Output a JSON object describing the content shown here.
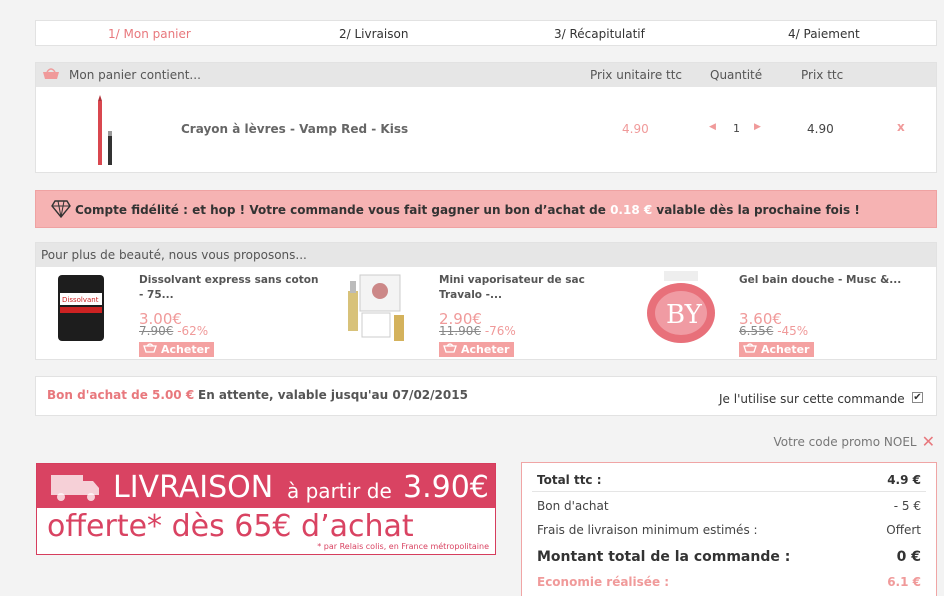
{
  "steps": {
    "s1": "1/ Mon panier",
    "s2": "2/ Livraison",
    "s3": "3/ Récapitulatif",
    "s4": "4/ Paiement"
  },
  "cart": {
    "heading": "Mon panier contient...",
    "col_unit": "Prix unitaire ttc",
    "col_qty": "Quantité",
    "col_total": "Prix ttc",
    "item": {
      "name": "Crayon à lèvres - Vamp Red - Kiss",
      "unit_price": "4.90",
      "qty": "1",
      "total": "4.90",
      "remove": "x"
    }
  },
  "loyalty": {
    "before": "Compte fidélité : et hop ! Votre commande vous fait gagner un bon d’achat de ",
    "amount": "0.18 €",
    "after": " valable dès la prochaine fois !"
  },
  "suggest": {
    "heading": "Pour plus de beauté, nous vous proposons...",
    "buy_label": "Acheter",
    "products": [
      {
        "name": "Dissolvant express sans coton - 75...",
        "price": "3.00€",
        "old": "7.90€",
        "disc": "-62%"
      },
      {
        "name": "Mini vaporisateur de sac Travalo -...",
        "price": "2.90€",
        "old": "11.90€",
        "disc": "-76%"
      },
      {
        "name": "Gel bain douche - Musc &...",
        "price": "3.60€",
        "old": "6.55€",
        "disc": "-45%"
      }
    ]
  },
  "voucher": {
    "title": "Bon d'achat de 5.00 €",
    "status": "En attente, valable jusqu'au 07/02/2015",
    "use_label": "Je l'utilise sur cette commande",
    "checked": true
  },
  "promo": {
    "label": "Votre code promo NOEL"
  },
  "banner": {
    "livraison": "LIVRAISON",
    "a_partir": "à partir de",
    "price": "3.90€",
    "offerte": "offerte* dès 65€ d’achat",
    "note": "* par Relais colis, en France métropolitaine"
  },
  "totals": {
    "total_label": "Total ttc :",
    "total_value": "4.9 €",
    "voucher_label": "Bon d'achat",
    "voucher_value": "- 5 €",
    "ship_label": "Frais de livraison minimum estimés :",
    "ship_value": "Offert",
    "grand_label": "Montant total de la commande :",
    "grand_value": "0 €",
    "saving_label": "Economie réalisée :",
    "saving_value": "6.1 €"
  },
  "colors": {
    "accent": "#e8787d",
    "loyalty_bg": "#f6b3b3",
    "banner": "#d94362"
  }
}
